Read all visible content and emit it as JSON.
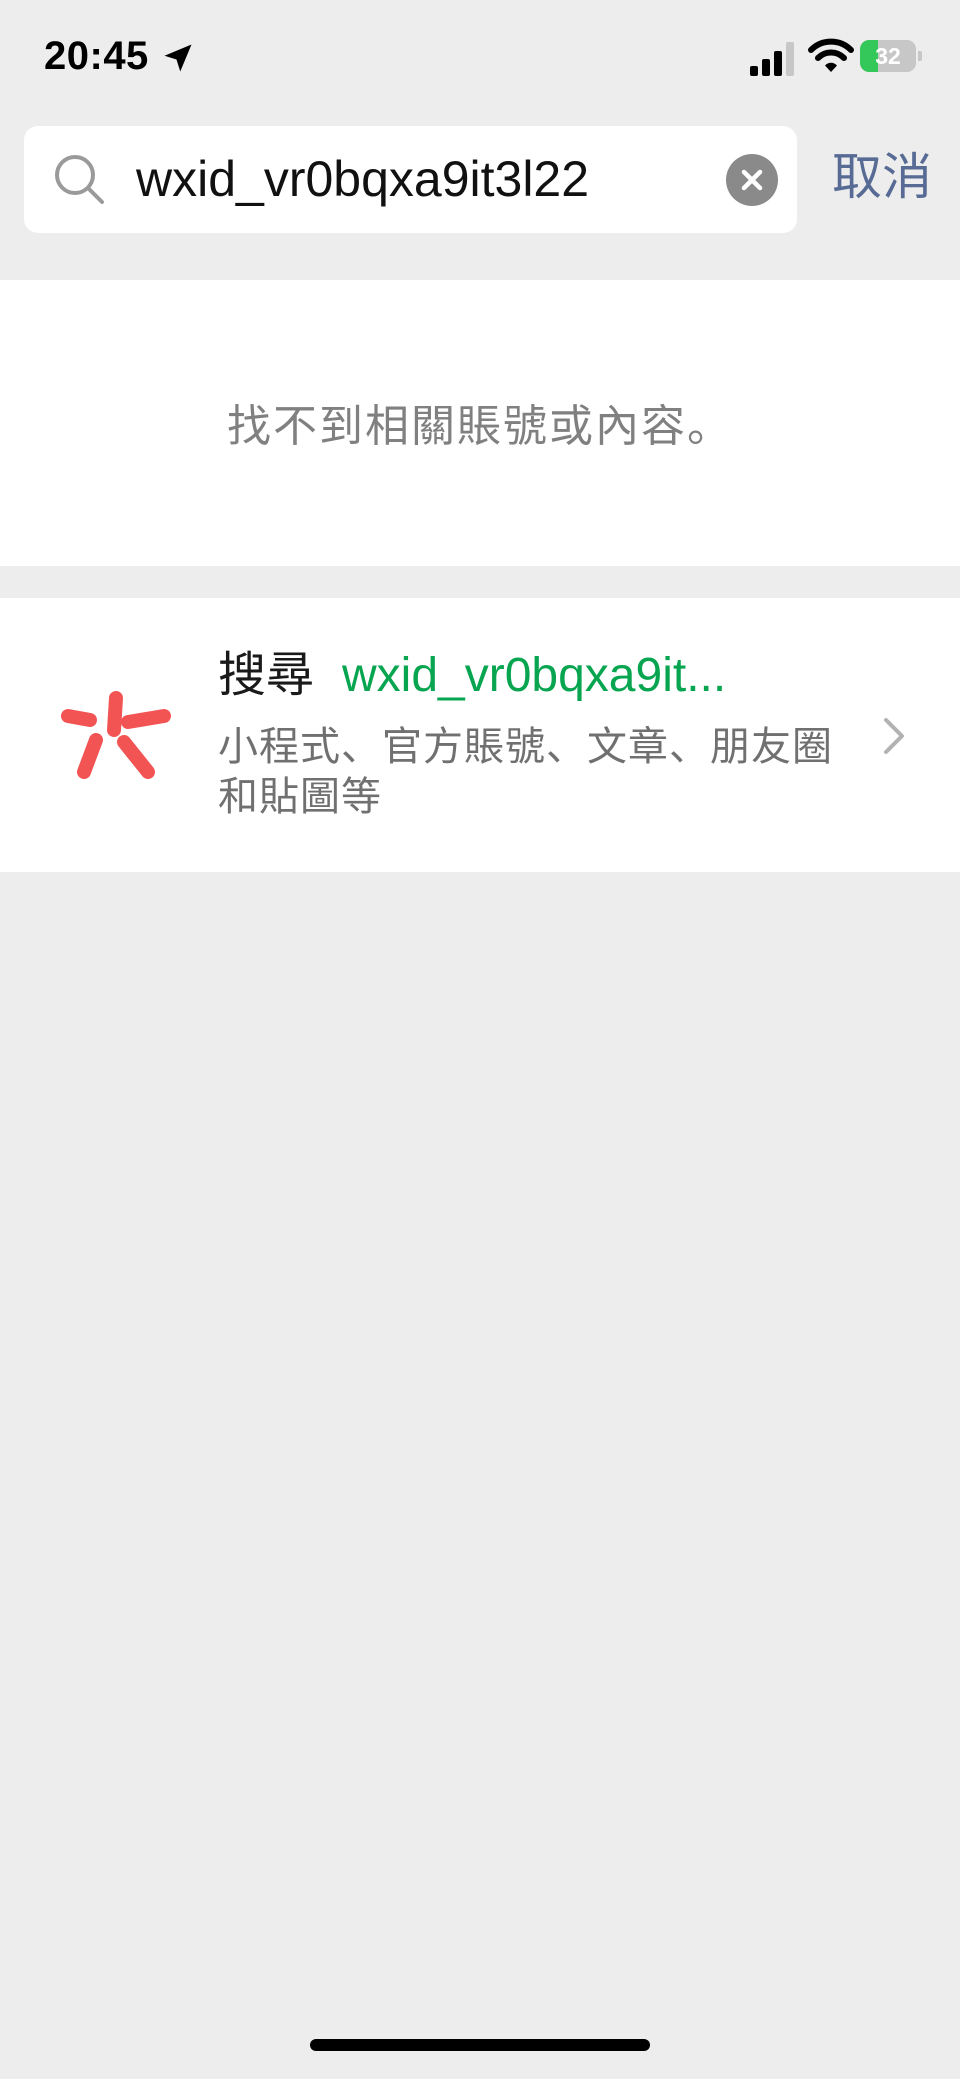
{
  "status_bar": {
    "time": "20:45",
    "battery_level": "32",
    "battery_fraction": 0.32,
    "battery_color": "#34c759",
    "icons": [
      "location-arrow-icon",
      "signal-icon",
      "wifi-icon",
      "battery-icon"
    ]
  },
  "search": {
    "icon": "search-icon",
    "query": "wxid_vr0bqxa9it3l22",
    "clear_icon": "clear-icon",
    "cancel_label": "取消"
  },
  "results": {
    "empty_message": "找不到相關賬號或內容。"
  },
  "search_item": {
    "icon": "wechat-search-logo-icon",
    "title_prefix": "搜尋",
    "title_query": "wxid_vr0bqxa9it...",
    "subtitle": "小程式、官方賬號、文章、朋友圈和貼圖等",
    "chevron": "chevron-right-icon"
  },
  "colors": {
    "accent_green": "#07a550",
    "link_blue": "#576b95",
    "logo_red": "#f25454",
    "background": "#ededed"
  }
}
